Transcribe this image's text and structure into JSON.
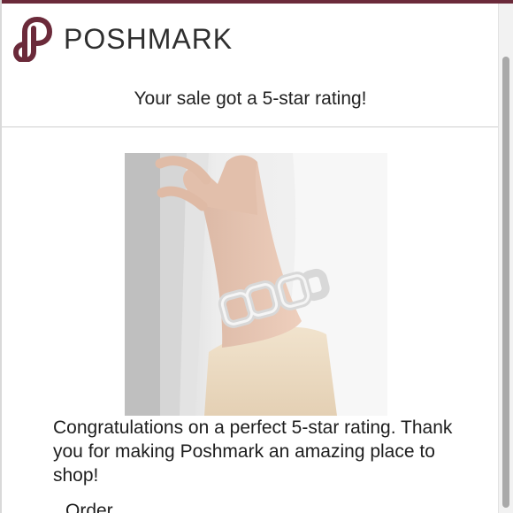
{
  "brand": {
    "name": "POSHMARK",
    "accent_color": "#6b2a3a",
    "logo_icon": "poshmark-logo-icon"
  },
  "email": {
    "subject": "Your sale got a 5-star rating!",
    "message": "Congratulations on a perfect 5-star rating. Thank you for making Poshmark an amazing place to shop!",
    "order_label": "Order"
  },
  "photo": {
    "subject": "product-photo"
  }
}
